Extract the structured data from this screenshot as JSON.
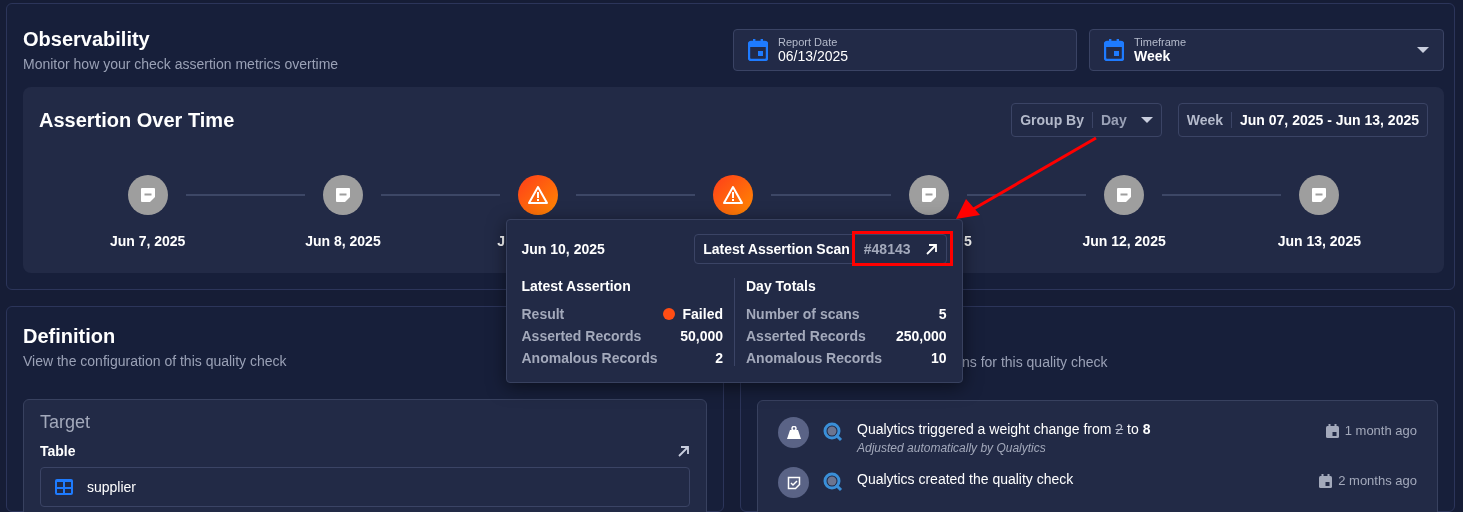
{
  "header": {
    "title": "Observability",
    "subtitle": "Monitor how your check assertion metrics overtime"
  },
  "report_date": {
    "label": "Report Date",
    "value": "06/13/2025"
  },
  "timeframe": {
    "label": "Timeframe",
    "value": "Week"
  },
  "assertion_over_time": {
    "title": "Assertion Over Time",
    "group_by": {
      "label": "Group By",
      "value": "Day"
    },
    "range": {
      "label": "Week",
      "value": "Jun 07, 2025 - Jun 13, 2025"
    },
    "nodes": [
      {
        "label": "Jun 7, 2025",
        "alert": false,
        "selected": false
      },
      {
        "label": "Jun 8, 2025",
        "alert": false,
        "selected": false
      },
      {
        "label": "J",
        "alert": true,
        "selected": false
      },
      {
        "alert": true,
        "selected": true
      },
      {
        "label": "5",
        "alert": false,
        "selected": false
      },
      {
        "label": "Jun 12, 2025",
        "alert": false,
        "selected": false
      },
      {
        "label": "Jun 13, 2025",
        "alert": false,
        "selected": false
      }
    ]
  },
  "tooltip": {
    "date": "Jun 10, 2025",
    "scan_label": "Latest Assertion Scan",
    "scan_id": "#48143",
    "latest": {
      "title": "Latest Assertion",
      "rows": [
        {
          "label": "Result",
          "value": "Failed",
          "color": "#ff4d14"
        },
        {
          "label": "Asserted Records",
          "value": "50,000"
        },
        {
          "label": "Anomalous Records",
          "value": "2"
        }
      ]
    },
    "totals": {
      "title": "Day Totals",
      "rows": [
        {
          "label": "Number of scans",
          "value": "5"
        },
        {
          "label": "Asserted Records",
          "value": "250,000"
        },
        {
          "label": "Anomalous Records",
          "value": "10"
        }
      ]
    }
  },
  "definition": {
    "title": "Definition",
    "subtitle": "View the configuration of this quality check",
    "target": {
      "title": "Target",
      "label": "Table",
      "value": "supplier"
    }
  },
  "activity": {
    "subtitle": "ns for this quality check",
    "events": [
      {
        "kind": "weight",
        "before": "Qualytics triggered a weight change from ",
        "old": "2",
        "middle": " to ",
        "new": "8",
        "note": "Adjusted automatically by Qualytics",
        "time": "1 month ago"
      },
      {
        "kind": "created",
        "text": "Qualytics created the quality check",
        "time": "2 months ago"
      }
    ]
  }
}
